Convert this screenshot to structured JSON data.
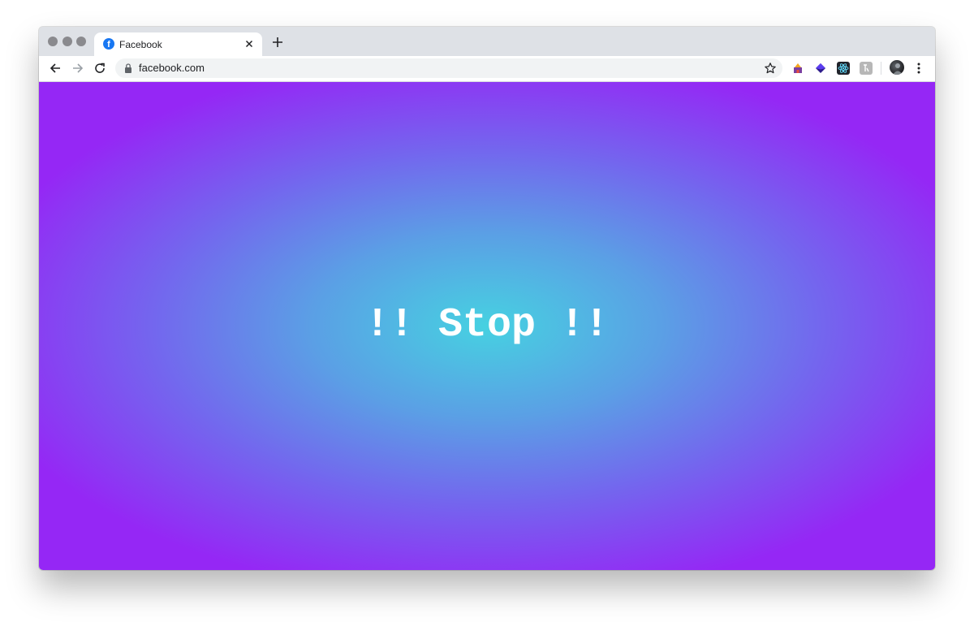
{
  "browser": {
    "tab": {
      "title": "Facebook",
      "favicon": "facebook-icon",
      "close_icon": "close-icon"
    },
    "new_tab_icon": "plus-icon",
    "toolbar": {
      "back_icon": "back-arrow-icon",
      "forward_icon": "forward-arrow-icon",
      "reload_icon": "reload-icon",
      "lock_icon": "lock-icon",
      "url": "facebook.com",
      "bookmark_icon": "star-icon",
      "extensions": [
        "extension-icon",
        "extension-icon",
        "react-devtools-icon",
        "extension-icon"
      ],
      "profile_icon": "profile-avatar",
      "menu_icon": "kebab-menu-icon"
    }
  },
  "page": {
    "message": "!! Stop !!",
    "colors": {
      "center": "#46d1e1",
      "edge": "#9527f5",
      "text": "#ffffff"
    }
  }
}
